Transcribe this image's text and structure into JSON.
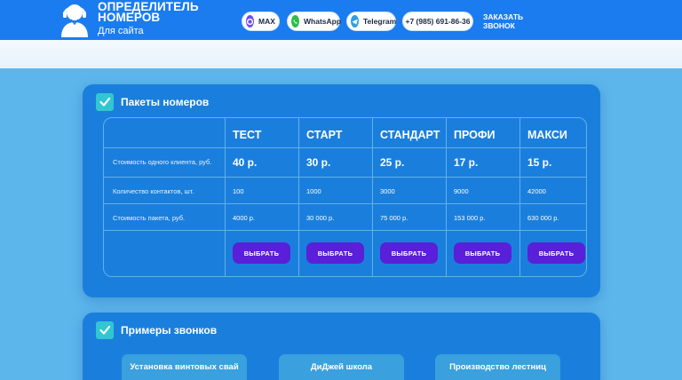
{
  "header": {
    "logo_title_1": "ОПРЕДЕЛИТЕЛЬ",
    "logo_title_2": "НОМЕРОВ",
    "logo_sub": "Для сайта",
    "max_label": "MAX",
    "whatsapp_label": "WhatsApp",
    "telegram_label": "Telegram",
    "phone": "+7 (985) 691-86-36",
    "callback_label": "ЗАКАЗАТЬ ЗВОНОК"
  },
  "packages": {
    "title": "Пакеты номеров",
    "plans": [
      {
        "name": "ТЕСТ",
        "price_per_client": "40 р.",
        "contacts": "100",
        "total": "4000 р.",
        "button": "ВЫБРАТЬ"
      },
      {
        "name": "СТАРТ",
        "price_per_client": "30 р.",
        "contacts": "1000",
        "total": "30 000 р.",
        "button": "ВЫБРАТЬ"
      },
      {
        "name": "СТАНДАРТ",
        "price_per_client": "25 р.",
        "contacts": "3000",
        "total": "75 000 р.",
        "button": "ВЫБРАТЬ"
      },
      {
        "name": "ПРОФИ",
        "price_per_client": "17 р.",
        "contacts": "9000",
        "total": "153 000 р.",
        "button": "ВЫБРАТЬ"
      },
      {
        "name": "МАКСИ",
        "price_per_client": "15 р.",
        "contacts": "42000",
        "total": "630 000 р.",
        "button": "ВЫБРАТЬ"
      }
    ],
    "row_labels": {
      "price_per_client": "Стоимость одного клиента, руб.",
      "contacts": "Количество контактов, шт.",
      "total": "Стоимость пакета, руб."
    }
  },
  "examples": {
    "title": "Примеры звонков",
    "items": [
      "Установка винтовых свай",
      "ДиДжей школа",
      "Производство лестниц"
    ]
  },
  "colors": {
    "header_bg": "#1b7cf0",
    "page_bg": "#5cb6ec",
    "card_bg": "#1a7fdc",
    "button_bg": "#5a1fd8",
    "check_bg": "#32c6d3"
  }
}
